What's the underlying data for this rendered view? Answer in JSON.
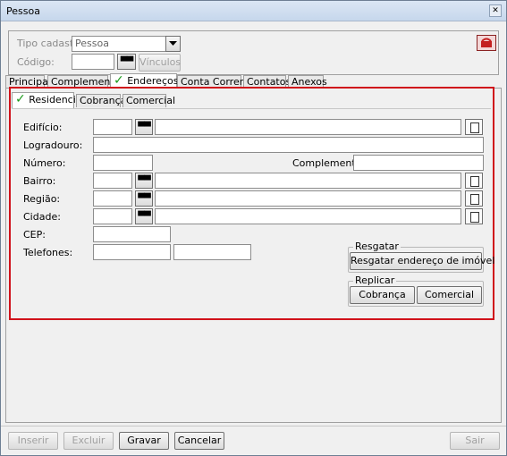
{
  "window": {
    "title": "Pessoa"
  },
  "header": {
    "tipo_cadastro_label": "Tipo cadastro",
    "tipo_cadastro_value": "Pessoa",
    "codigo_label": "Código:",
    "codigo_value": "",
    "vinculos_button": "Vínculos"
  },
  "main_tabs": [
    "Principal",
    "Complementar",
    "Endereços",
    "Conta Corrente",
    "Contatos",
    "Anexos"
  ],
  "sub_tabs": [
    "Residencial",
    "Cobrança",
    "Comercial"
  ],
  "form": {
    "edificio_label": "Edifício:",
    "logradouro_label": "Logradouro:",
    "numero_label": "Número:",
    "complemento_label": "Complemento:",
    "bairro_label": "Bairro:",
    "regiao_label": "Região:",
    "cidade_label": "Cidade:",
    "cep_label": "CEP:",
    "telefones_label": "Telefones:"
  },
  "resgatar": {
    "title": "Resgatar",
    "button": "Resgatar endereço de imóvel"
  },
  "replicar": {
    "title": "Replicar",
    "cobranca_button": "Cobrança",
    "comercial_button": "Comercial"
  },
  "footer": {
    "inserir": "Inserir",
    "excluir": "Excluir",
    "gravar": "Gravar",
    "cancelar": "Cancelar",
    "sair": "Sair"
  },
  "colors": {
    "highlight_border": "#d0121b",
    "check": "#1a9a1a"
  },
  "icons": {
    "binoculars": "binoculars-icon",
    "page": "page-icon",
    "phone": "phone-icon",
    "dropdown": "chevron-down-icon"
  }
}
